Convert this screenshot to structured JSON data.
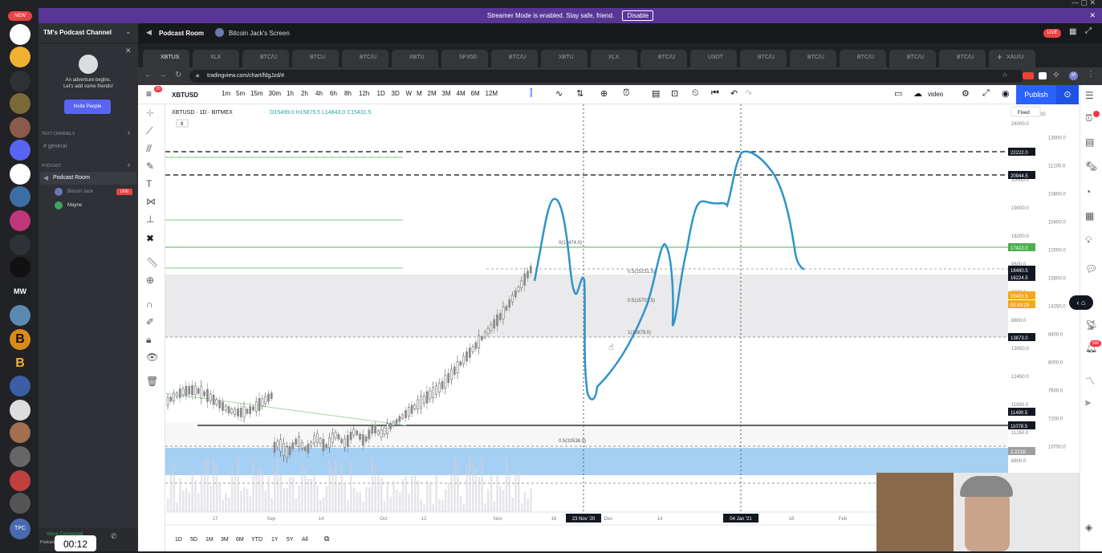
{
  "discord": {
    "badge": "NEW",
    "channel_title": "TM's Podcast Channel",
    "adventure_line1": "An adventure begins.",
    "adventure_line2": "Let's add some friends!",
    "invite_button": "Invite People",
    "text_channels_header": "TEXT CHANNELS",
    "general_channel": "general",
    "podcast_header": "PODCAST",
    "podcast_room": "Podcast Room",
    "user1": "Bitcoin Jack",
    "user1_badge": "LIVE",
    "user2": "Mayne",
    "voice_status": "Voice Connected",
    "voice_sub": "Podcast Room",
    "streamer_text": "Streamer Mode is enabled. Stay safe, friend.",
    "streamer_disable": "Disable",
    "header_room": "Podcast Room",
    "header_screen": "Bitcoin Jack's Screen",
    "live_badge": "LIVE",
    "timer": "00:12"
  },
  "browser": {
    "url": "tradingview.com/chart/fdgJzd/#",
    "tabs": [
      "XBTUS",
      "XLX",
      "BTC/U",
      "BTCU",
      "BTC/U",
      "XBTU",
      "SPX50",
      "BTC/U",
      "XBTU",
      "XLX",
      "BTC/U",
      "USDT",
      "BTC/U",
      "BTC/U",
      "BTC/U",
      "BTC/U",
      "BTC/U",
      "XAU/U"
    ]
  },
  "tradingview": {
    "symbol": "XBTUSD",
    "timeframes_top": [
      "1m",
      "5m",
      "15m",
      "30m",
      "1h",
      "2h",
      "4h",
      "6h",
      "8h",
      "12h",
      "1D",
      "3D",
      "W",
      "M",
      "2M",
      "3M",
      "4M",
      "6M",
      "12M"
    ],
    "header_line": "XBTUSD · 1D · BITMEX",
    "ohlc": "O15499.0 H15875.5 L14843.0 C15431.5",
    "indicator": "8",
    "video_label": "video",
    "publish_button": "Publish",
    "axis_currency": "USD",
    "fixed_label": "Fixed",
    "price_ticks": [
      "24000.0",
      "13000.0",
      "11600.0",
      "11200.0",
      "20000.0",
      "10800.0",
      "19000.0",
      "10400.0",
      "18200.0",
      "10000.0",
      "9600.0",
      "15800.0",
      "9200.0",
      "14250.0",
      "8800.0",
      "8400.0",
      "13050.0",
      "8000.0",
      "12450.0",
      "7600.0",
      "11850.0",
      "7200.0",
      "11250.0",
      "10750.0",
      "6800.0",
      "6400.0",
      "9950.0",
      "6000.0"
    ],
    "price_labels": [
      {
        "text": "22222.0",
        "color": "#131722"
      },
      {
        "text": "20944.5",
        "color": "#131722"
      },
      {
        "text": "17422.0",
        "color": "#4caf50"
      },
      {
        "text": "16480.5",
        "color": "#131722"
      },
      {
        "text": "16224.5",
        "color": "#131722"
      },
      {
        "text": "15431.5",
        "color": "#f5a623"
      },
      {
        "text": "02:43:29",
        "color": "#f5a623"
      },
      {
        "text": "13873.0",
        "color": "#131722"
      },
      {
        "text": "11490.5",
        "color": "#131722"
      },
      {
        "text": "11078.5",
        "color": "#131722"
      },
      {
        "text": "2.221B",
        "color": "#9e9e9e"
      }
    ],
    "fib_labels": [
      "0(17474.0)",
      "0.5(15231.5)",
      "0.5(15701.5)",
      "1(12879.0)",
      "0.5(10538.0)"
    ],
    "time_axis": [
      "17",
      "Sep",
      "14",
      "Oct",
      "12",
      "Nov",
      "16",
      "23 Nov '20",
      "Dec",
      "14",
      "04 Jan '21",
      "18",
      "Feb"
    ],
    "bottom_ranges": [
      "1D",
      "5D",
      "1M",
      "3M",
      "6M",
      "YTD",
      "1Y",
      "5Y",
      "All"
    ]
  }
}
